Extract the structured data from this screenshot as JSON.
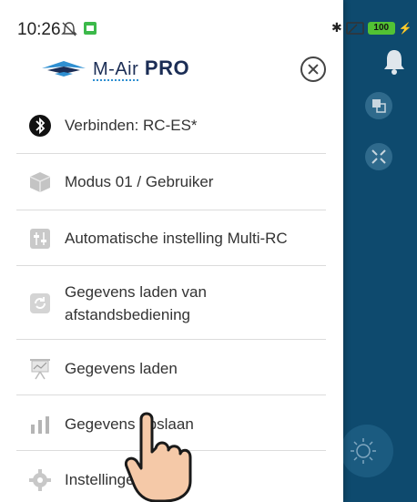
{
  "status_bar": {
    "time": "10:26",
    "battery": "100"
  },
  "header": {
    "logo_small": "M-Air",
    "logo_big": "PRO"
  },
  "menu": {
    "items": [
      {
        "label": "Verbinden: RC-ES*",
        "icon": "bluetooth-icon"
      },
      {
        "label": "Modus 01 / Gebruiker",
        "icon": "cube-icon"
      },
      {
        "label": "Automatische instelling Multi-RC",
        "icon": "sliders-icon"
      },
      {
        "label_line1": "Gegevens laden van",
        "label_line2": "afstandsbediening",
        "icon": "sync-icon"
      },
      {
        "label": "Gegevens laden",
        "icon": "presentation-icon"
      },
      {
        "label": "Gegevens opslaan",
        "icon": "bar-chart-icon"
      },
      {
        "label": "Instellingen",
        "icon": "gear-icon"
      }
    ]
  },
  "colors": {
    "app_background": "#0e4a6e",
    "accent": "#2f8fd1",
    "logo": "#1b2d55"
  }
}
